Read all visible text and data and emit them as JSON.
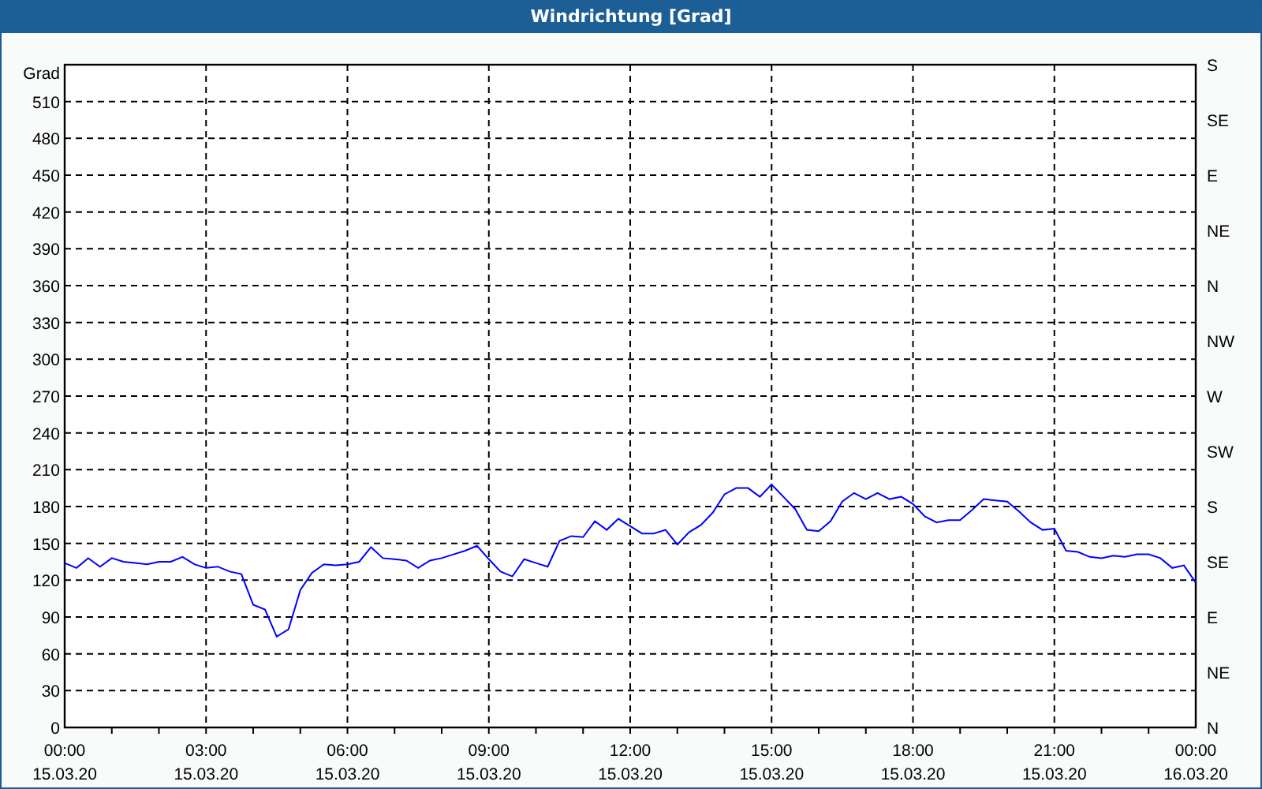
{
  "window": {
    "title": "Windrichtung [Grad]"
  },
  "chart": {
    "right_axis_labels": [
      "S",
      "SE",
      "E",
      "NE",
      "N",
      "NW",
      "W",
      "SW",
      "S",
      "SE",
      "E",
      "NE",
      "N"
    ],
    "chart_data": {
      "type": "line",
      "grid": true,
      "ylabel": "Grad",
      "ylim": [
        0,
        540
      ],
      "yticks": [
        0,
        30,
        60,
        90,
        120,
        150,
        180,
        210,
        240,
        270,
        300,
        330,
        360,
        390,
        420,
        450,
        480,
        510
      ],
      "categories": [
        "00:00\n15.03.20",
        null,
        null,
        null,
        null,
        null,
        null,
        null,
        null,
        null,
        null,
        null,
        "03:00\n15.03.20",
        null,
        null,
        null,
        null,
        null,
        null,
        null,
        null,
        null,
        null,
        null,
        "06:00\n15.03.20",
        null,
        null,
        null,
        null,
        null,
        null,
        null,
        null,
        null,
        null,
        null,
        "09:00\n15.03.20",
        null,
        null,
        null,
        null,
        null,
        null,
        null,
        null,
        null,
        null,
        null,
        "12:00\n15.03.20",
        null,
        null,
        null,
        null,
        null,
        null,
        null,
        null,
        null,
        null,
        null,
        "15:00\n15.03.20",
        null,
        null,
        null,
        null,
        null,
        null,
        null,
        null,
        null,
        null,
        null,
        "18:00\n15.03.20",
        null,
        null,
        null,
        null,
        null,
        null,
        null,
        null,
        null,
        null,
        null,
        "21:00\n15.03.20",
        null,
        null,
        null,
        null,
        null,
        null,
        null,
        null,
        null,
        null,
        null,
        "00:00\n16.03.20"
      ],
      "series": [
        {
          "color": "#0000ff",
          "values": [
            134,
            130,
            138,
            131,
            138,
            135,
            134,
            133,
            135,
            135,
            139,
            133,
            130,
            131,
            127,
            125,
            100,
            96,
            74,
            80,
            112,
            126,
            133,
            132,
            133,
            135,
            147,
            138,
            137,
            136,
            130,
            136,
            138,
            141,
            144,
            148,
            137,
            127,
            123,
            137,
            134,
            131,
            152,
            156,
            155,
            168,
            161,
            170,
            164,
            158,
            158,
            161,
            149,
            159,
            165,
            175,
            190,
            195,
            195,
            188,
            198,
            188,
            178,
            161,
            160,
            168,
            184,
            191,
            186,
            191,
            186,
            188,
            182,
            172,
            167,
            169,
            169,
            177,
            186,
            185,
            184,
            176,
            167,
            161,
            162,
            144,
            143,
            139,
            138,
            140,
            139,
            141,
            141,
            138,
            130,
            132,
            118
          ]
        }
      ]
    }
  }
}
